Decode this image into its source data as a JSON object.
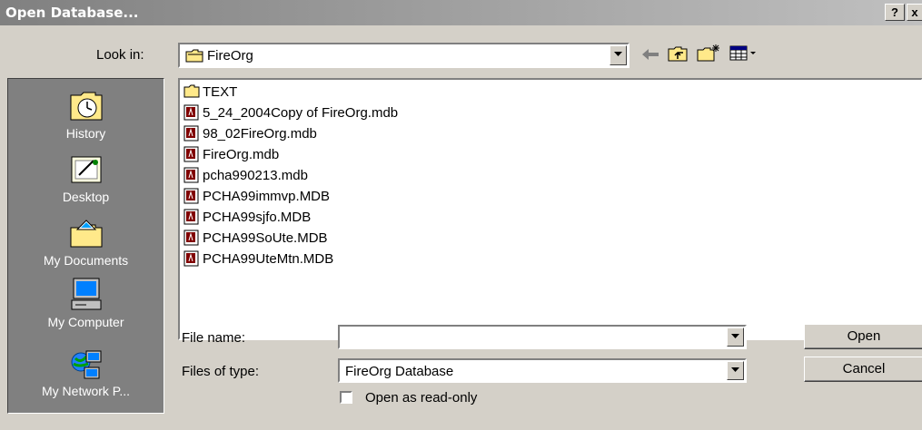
{
  "window": {
    "title": "Open Database...",
    "help_btn": "?",
    "close_btn": "x"
  },
  "toolbar": {
    "look_in_label": "Look in:",
    "look_in_value": "FireOrg",
    "icons": [
      "back-arrow-icon",
      "up-folder-icon",
      "new-folder-icon",
      "view-menu-icon"
    ]
  },
  "places": [
    {
      "label": "History",
      "icon": "history-icon"
    },
    {
      "label": "Desktop",
      "icon": "desktop-icon"
    },
    {
      "label": "My Documents",
      "icon": "my-documents-icon"
    },
    {
      "label": "My Computer",
      "icon": "my-computer-icon"
    },
    {
      "label": "My Network P...",
      "icon": "my-network-places-icon"
    }
  ],
  "files": [
    {
      "name": "TEXT",
      "type": "folder"
    },
    {
      "name": "5_24_2004Copy of FireOrg.mdb",
      "type": "mdb"
    },
    {
      "name": "98_02FireOrg.mdb",
      "type": "mdb"
    },
    {
      "name": "FireOrg.mdb",
      "type": "mdb"
    },
    {
      "name": "pcha990213.mdb",
      "type": "mdb"
    },
    {
      "name": "PCHA99immvp.MDB",
      "type": "mdb"
    },
    {
      "name": "PCHA99sjfo.MDB",
      "type": "mdb"
    },
    {
      "name": "PCHA99SoUte.MDB",
      "type": "mdb"
    },
    {
      "name": "PCHA99UteMtn.MDB",
      "type": "mdb"
    }
  ],
  "form": {
    "file_name_label": "File name:",
    "file_name_value": "",
    "files_of_type_label": "Files of type:",
    "files_of_type_value": "FireOrg Database",
    "read_only_label": "Open as read-only",
    "read_only_checked": false
  },
  "buttons": {
    "open": "Open",
    "cancel": "Cancel"
  },
  "colors": {
    "title_start": "#808080",
    "title_end": "#c0c0c0",
    "face": "#d4d0c8",
    "places_bg": "#808080",
    "mdb_icon": "#800000"
  }
}
